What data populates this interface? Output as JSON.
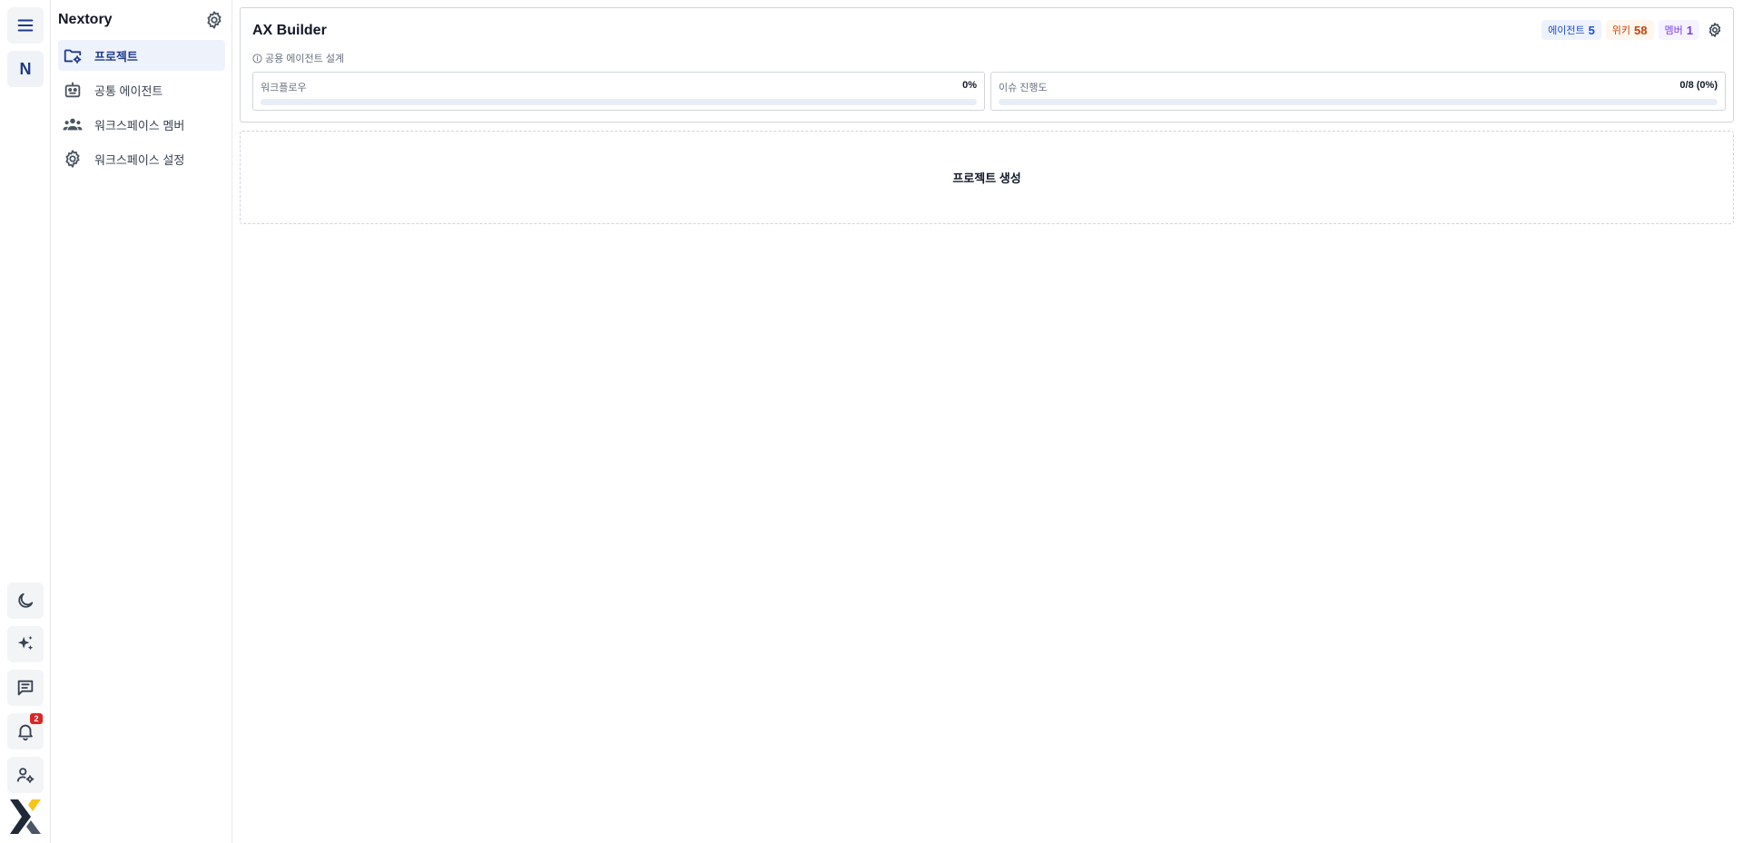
{
  "workspace": {
    "initial": "N",
    "name": "Nextory"
  },
  "notifications": {
    "count": "2"
  },
  "sidebar": {
    "items": [
      {
        "label": "프로젝트",
        "icon": "folder-settings-icon",
        "active": true
      },
      {
        "label": "공통 에이전트",
        "icon": "robot-icon",
        "active": false
      },
      {
        "label": "워크스페이스 멤버",
        "icon": "group-icon",
        "active": false
      },
      {
        "label": "워크스페이스 설정",
        "icon": "gear-icon",
        "active": false
      }
    ]
  },
  "project": {
    "title": "AX Builder",
    "description": "공용 에이전트 설계",
    "chips": {
      "agents": {
        "label": "에이전트",
        "count": "5"
      },
      "wiki": {
        "label": "위키",
        "count": "58"
      },
      "members": {
        "label": "멤버",
        "count": "1"
      }
    },
    "workflow": {
      "label": "워크플로우",
      "value": "0%",
      "fraction": 0
    },
    "issues": {
      "label": "이슈 진행도",
      "value": "0/8 (0%)",
      "fraction": 0
    }
  },
  "create_project": {
    "label": "프로젝트 생성"
  },
  "colors": {
    "accent": "#1e3a8a",
    "badge": "#dc2626",
    "agent_chip": "#1d4ed8",
    "wiki_chip": "#c2410c",
    "member_chip": "#7c3aed",
    "logo_yellow": "#f5c518"
  }
}
